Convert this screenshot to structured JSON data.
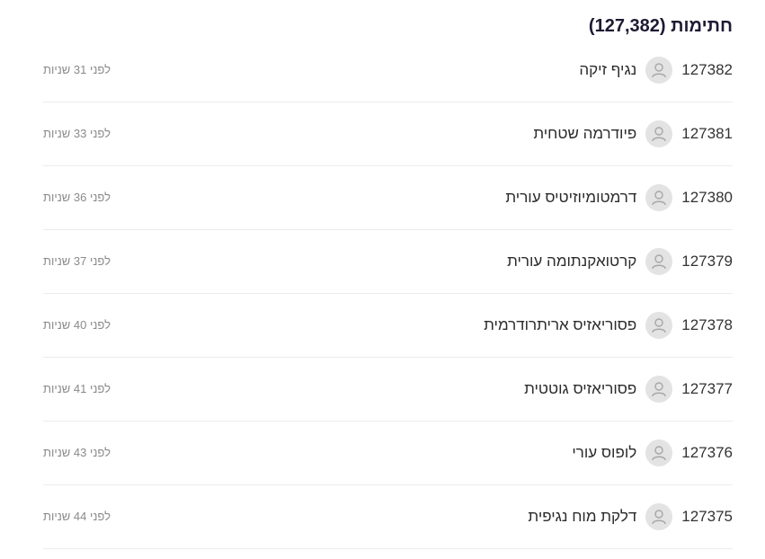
{
  "signatures": {
    "title": "חתימות (127,382)",
    "items": [
      {
        "number": "127382",
        "name": "נגיף זיקה",
        "time": "לפני 31 שניות"
      },
      {
        "number": "127381",
        "name": "פיודרמה שטחית",
        "time": "לפני 33 שניות"
      },
      {
        "number": "127380",
        "name": "דרמטומיוזיטיס עורית",
        "time": "לפני 36 שניות"
      },
      {
        "number": "127379",
        "name": "קרטואקנתומה עורית",
        "time": "לפני 37 שניות"
      },
      {
        "number": "127378",
        "name": "פסוריאזיס אריתרודרמית",
        "time": "לפני 40 שניות"
      },
      {
        "number": "127377",
        "name": "פסוריאזיס גוטטית",
        "time": "לפני 41 שניות"
      },
      {
        "number": "127376",
        "name": "לופוס עורי",
        "time": "לפני 43 שניות"
      },
      {
        "number": "127375",
        "name": "דלקת מוח נגיפית",
        "time": "לפני 44 שניות"
      }
    ],
    "avatar_icon": "user-placeholder-icon"
  }
}
